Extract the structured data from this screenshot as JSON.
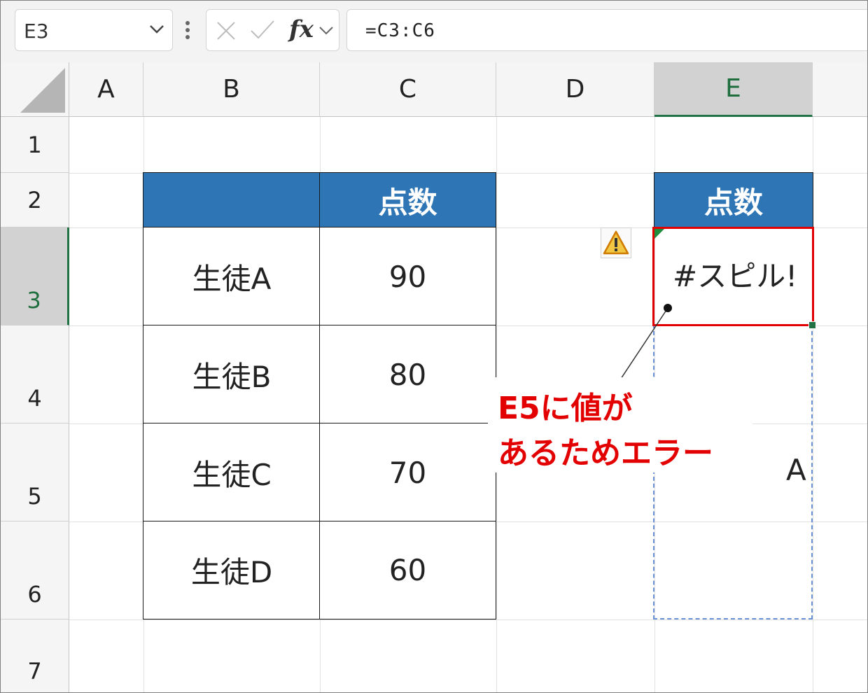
{
  "formula_bar": {
    "name_box": "E3",
    "fx_label": "fx",
    "formula": "=C3:C6"
  },
  "columns": [
    "A",
    "B",
    "C",
    "D",
    "E"
  ],
  "rows": [
    "1",
    "2",
    "3",
    "4",
    "5",
    "6",
    "7"
  ],
  "table": {
    "header": "点数",
    "students": [
      {
        "name": "生徒A",
        "score": "90"
      },
      {
        "name": "生徒B",
        "score": "80"
      },
      {
        "name": "生徒C",
        "score": "70"
      },
      {
        "name": "生徒D",
        "score": "60"
      }
    ]
  },
  "result": {
    "header": "点数",
    "error": "#スピル!",
    "blocking_value": "A"
  },
  "callout": {
    "line1": "E5に値が",
    "line2": "あるためエラー"
  },
  "colors": {
    "header_fill": "#2e75b6",
    "selection_border": "#e00000",
    "callout_text": "#e20000",
    "spill_border": "#6a92d4",
    "excel_green": "#217346"
  },
  "icons": [
    "chevron-down-icon",
    "more-options-icon",
    "cancel-icon",
    "enter-check-icon",
    "warning-icon"
  ]
}
